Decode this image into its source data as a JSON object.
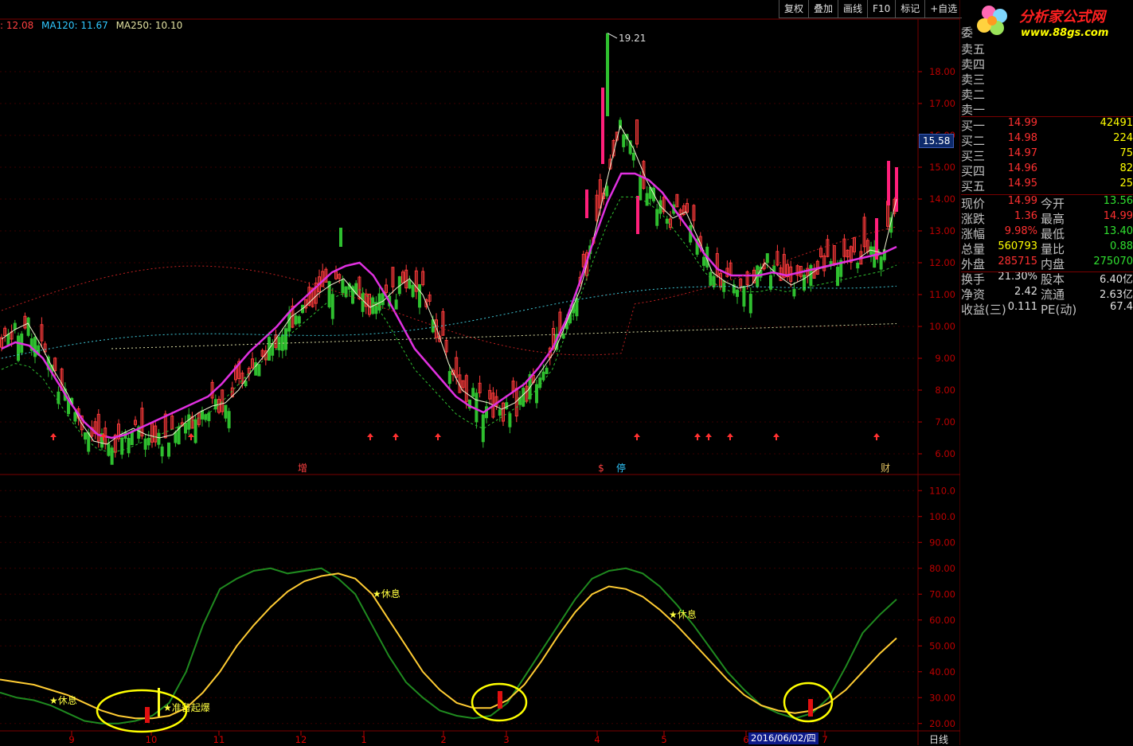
{
  "toolbar": {
    "buttons": [
      "复权",
      "叠加",
      "画线",
      "F10",
      "标记",
      "+自选"
    ]
  },
  "ma_legend": [
    {
      "label": ": 12.08",
      "color": "#ff4040"
    },
    {
      "label": "MA120: 11.67",
      "color": "#30c8ff"
    },
    {
      "label": "MA250: 10.10",
      "color": "#e0e0a0"
    }
  ],
  "logo": {
    "name": "分析家公式网",
    "url": "www.88gs.com"
  },
  "chart_data": [
    {
      "type": "candlestick",
      "title": "",
      "ylim": [
        5.5,
        19.5
      ],
      "y_ticks": [
        "18.00",
        "17.00",
        "16.00",
        "15.00",
        "14.00",
        "13.00",
        "12.00",
        "11.00",
        "10.00",
        "9.00",
        "8.00",
        "7.00",
        "6.00"
      ],
      "high_annotation": "19.21",
      "current_price_tag": "15.58",
      "event_markers": [
        "增",
        "$",
        "停",
        "财"
      ],
      "ma_short_white": [
        9.6,
        9.9,
        10.1,
        9.4,
        8.6,
        7.9,
        7.0,
        6.4,
        6.3,
        6.6,
        6.8,
        6.6,
        6.5,
        6.6,
        7.0,
        7.3,
        7.5,
        7.6,
        8.0,
        8.6,
        9.1,
        9.7,
        10.3,
        10.6,
        11.0,
        11.3,
        11.5,
        11.0,
        10.6,
        10.8,
        11.2,
        11.5,
        11.0,
        10.0,
        8.8,
        8.0,
        7.7,
        7.6,
        7.4,
        7.6,
        8.0,
        8.6,
        9.2,
        10.2,
        11.2,
        12.8,
        14.6,
        16.3,
        15.6,
        14.6,
        13.8,
        13.4,
        13.6,
        12.7,
        11.7,
        11.4,
        11.2,
        11.3,
        12.0,
        11.6,
        11.3,
        11.5,
        11.8,
        11.9,
        12.0,
        12.1,
        12.4,
        12.3,
        14.0
      ],
      "ma_magenta": [
        9.3,
        9.5,
        9.4,
        9.0,
        8.3,
        7.6,
        7.0,
        6.6,
        6.5,
        6.6,
        6.8,
        7.0,
        7.2,
        7.4,
        7.6,
        7.8,
        8.2,
        8.7,
        9.2,
        9.6,
        10.0,
        10.5,
        10.9,
        11.3,
        11.7,
        11.9,
        12.0,
        11.6,
        10.9,
        10.1,
        9.3,
        8.8,
        8.3,
        7.8,
        7.5,
        7.3,
        7.6,
        7.9,
        8.2,
        8.7,
        9.3,
        10.2,
        11.4,
        12.7,
        13.9,
        14.8,
        14.8,
        14.6,
        14.2,
        13.6,
        13.0,
        12.3,
        11.8,
        11.6,
        11.6,
        11.6,
        11.7,
        11.6,
        11.7,
        11.8,
        11.9,
        12.0,
        12.1,
        12.2,
        12.3,
        12.5
      ],
      "ma120": 11.67,
      "ma250": 10.1
    },
    {
      "type": "line",
      "title": "",
      "ylim": [
        15,
        115
      ],
      "y_ticks": [
        "110.0",
        "100.0",
        "90.00",
        "80.00",
        "70.00",
        "60.00",
        "50.00",
        "40.00",
        "30.00",
        "20.00"
      ],
      "x_ticks": [
        "9",
        "10",
        "11",
        "12",
        "1",
        "2",
        "3",
        "4",
        "5",
        "6",
        "2016/06/02/四",
        "7"
      ],
      "annotations": [
        "休息",
        "准备起爆",
        "休息",
        "休息"
      ],
      "series": [
        {
          "name": "",
          "color": "#1f8a1f",
          "values": [
            32,
            30,
            29,
            27,
            24,
            21,
            20,
            20,
            21,
            23,
            28,
            40,
            58,
            72,
            76,
            79,
            80,
            78,
            79,
            80,
            76,
            70,
            58,
            46,
            36,
            30,
            25,
            23,
            22,
            23,
            28,
            38,
            48,
            58,
            68,
            76,
            79,
            80,
            78,
            73,
            66,
            58,
            49,
            40,
            33,
            27,
            24,
            22,
            24,
            30,
            42,
            55,
            62,
            68
          ]
        },
        {
          "name": "",
          "color": "#ffcc33",
          "values": [
            37,
            36,
            35,
            33,
            31,
            28,
            25,
            23,
            22,
            22,
            23,
            26,
            32,
            40,
            50,
            58,
            65,
            71,
            75,
            77,
            78,
            76,
            70,
            60,
            50,
            40,
            33,
            28,
            26,
            26,
            29,
            35,
            44,
            54,
            63,
            70,
            73,
            72,
            69,
            64,
            58,
            51,
            44,
            37,
            31,
            27,
            25,
            24,
            25,
            28,
            33,
            40,
            47,
            53
          ]
        }
      ]
    }
  ],
  "quote": {
    "header_label": "委",
    "asks": [
      {
        "label": "卖五",
        "price": "",
        "vol": ""
      },
      {
        "label": "卖四",
        "price": "",
        "vol": ""
      },
      {
        "label": "卖三",
        "price": "",
        "vol": ""
      },
      {
        "label": "卖二",
        "price": "",
        "vol": ""
      },
      {
        "label": "卖一",
        "price": "",
        "vol": ""
      }
    ],
    "bids": [
      {
        "label": "买一",
        "price": "14.99",
        "vol": "42491"
      },
      {
        "label": "买二",
        "price": "14.98",
        "vol": "224"
      },
      {
        "label": "买三",
        "price": "14.97",
        "vol": "75"
      },
      {
        "label": "买四",
        "price": "14.96",
        "vol": "82"
      },
      {
        "label": "买五",
        "price": "14.95",
        "vol": "25"
      }
    ],
    "stats": [
      {
        "l1": "现价",
        "v1": "14.99",
        "c1": "#ff3030",
        "l2": "今开",
        "v2": "13.56",
        "c2": "#30e030"
      },
      {
        "l1": "涨跌",
        "v1": "1.36",
        "c1": "#ff3030",
        "l2": "最高",
        "v2": "14.99",
        "c2": "#ff3030"
      },
      {
        "l1": "涨幅",
        "v1": "9.98%",
        "c1": "#ff3030",
        "l2": "最低",
        "v2": "13.40",
        "c2": "#30e030"
      },
      {
        "l1": "总量",
        "v1": "560793",
        "c1": "#ffff00",
        "l2": "量比",
        "v2": "0.88",
        "c2": "#30e030"
      },
      {
        "l1": "外盘",
        "v1": "285715",
        "c1": "#ff3030",
        "l2": "内盘",
        "v2": "275070",
        "c2": "#30e030"
      },
      {
        "l1": "换手",
        "v1": "21.30%",
        "c1": "#e0e0e0",
        "l2": "股本",
        "v2": "6.40亿",
        "c2": "#e0e0e0"
      },
      {
        "l1": "净资",
        "v1": "2.42",
        "c1": "#e0e0e0",
        "l2": "流通",
        "v2": "2.63亿",
        "c2": "#e0e0e0"
      },
      {
        "l1": "收益(三)",
        "v1": "0.111",
        "c1": "#e0e0e0",
        "l2": "PE(动)",
        "v2": "67.4",
        "c2": "#e0e0e0"
      }
    ]
  },
  "bottom_label": "日线"
}
